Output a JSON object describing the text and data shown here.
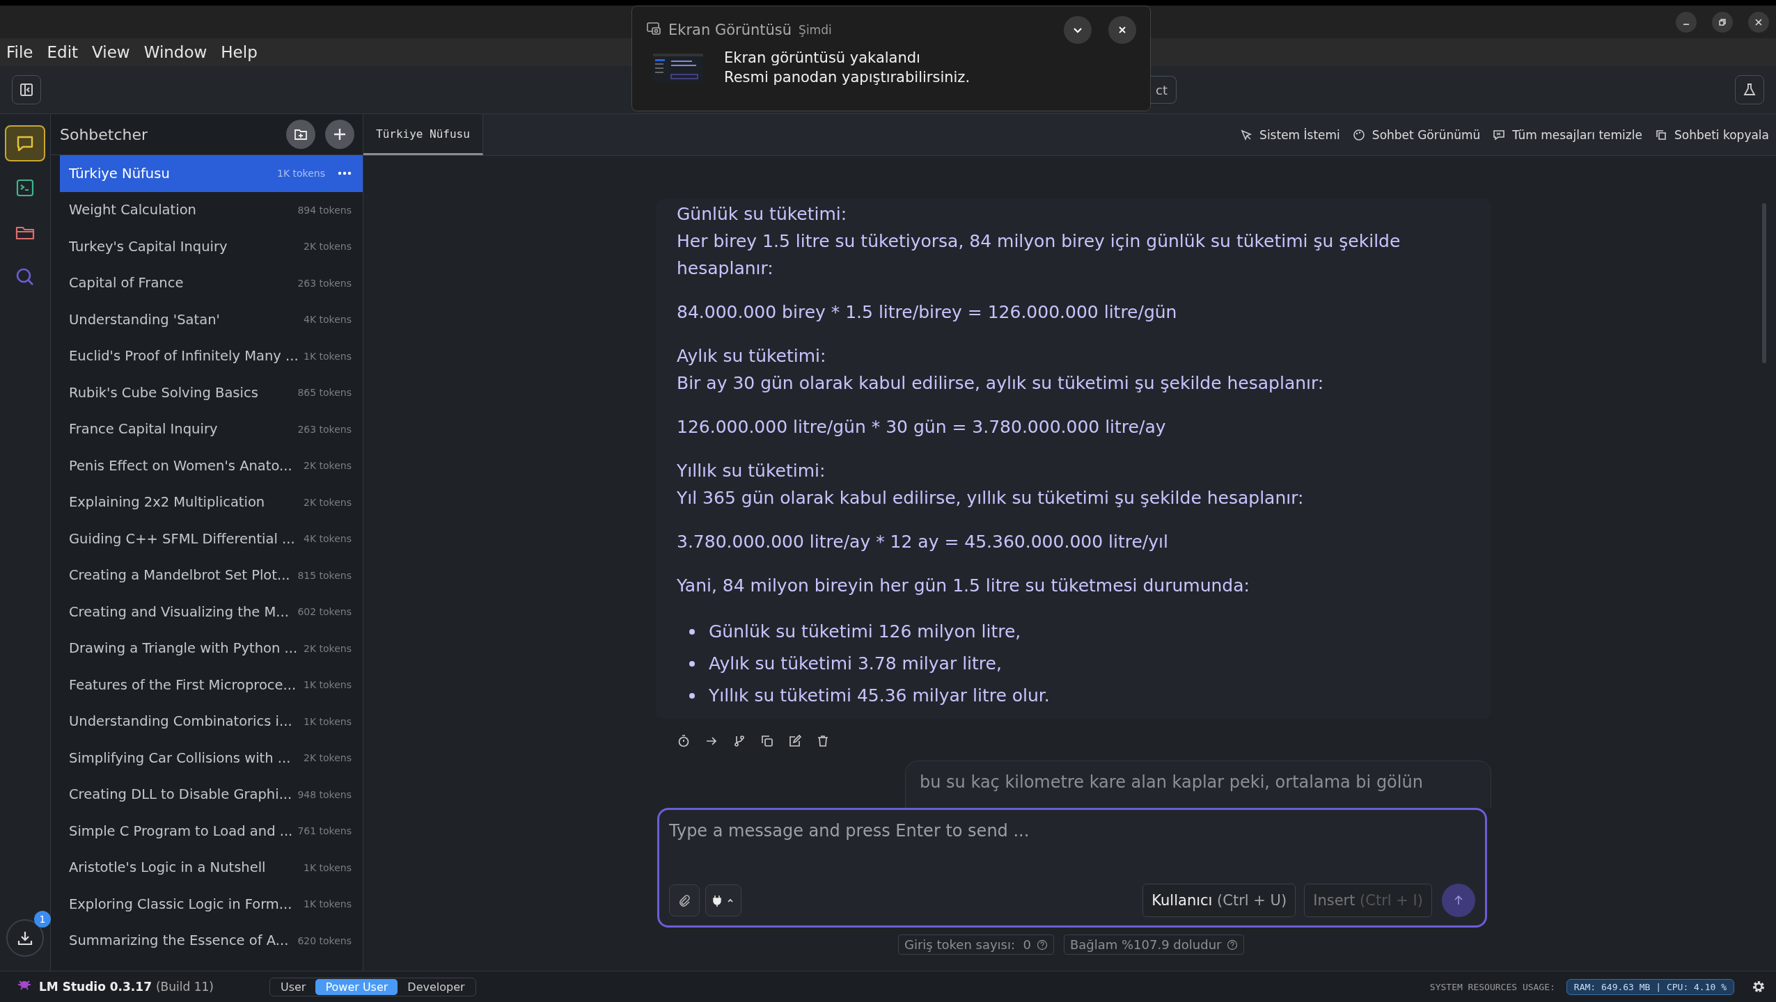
{
  "menu": [
    "File",
    "Edit",
    "View",
    "Window",
    "Help"
  ],
  "notification": {
    "app": "Ekran Görüntüsü",
    "time": "Şimdi",
    "title": "Ekran görüntüsü yakalandı",
    "body": "Resmi panodan yapıştırabilirsiniz."
  },
  "toolbar": {
    "hidden_button_label": "ct"
  },
  "rail": [
    {
      "kind": "chat",
      "selected": true
    },
    {
      "kind": "terminal",
      "selected": false
    },
    {
      "kind": "folder",
      "selected": false
    },
    {
      "kind": "search",
      "selected": false
    }
  ],
  "download_badge": "1",
  "sidebar": {
    "title": "Sohbetcher",
    "chats": [
      {
        "title": "Türkiye Nüfusu",
        "tokens": "1K tokens",
        "selected": true
      },
      {
        "title": "Weight Calculation",
        "tokens": "894 tokens",
        "selected": false
      },
      {
        "title": "Turkey's Capital Inquiry",
        "tokens": "2K tokens",
        "selected": false
      },
      {
        "title": "Capital of France",
        "tokens": "263 tokens",
        "selected": false
      },
      {
        "title": "Understanding 'Satan'",
        "tokens": "4K tokens",
        "selected": false
      },
      {
        "title": "Euclid's Proof of Infinitely Many ...",
        "tokens": "1K tokens",
        "selected": false
      },
      {
        "title": "Rubik's Cube Solving Basics",
        "tokens": "865 tokens",
        "selected": false
      },
      {
        "title": "France Capital Inquiry",
        "tokens": "263 tokens",
        "selected": false
      },
      {
        "title": "Penis Effect on Women's Anato...",
        "tokens": "2K tokens",
        "selected": false
      },
      {
        "title": "Explaining 2x2 Multiplication",
        "tokens": "2K tokens",
        "selected": false
      },
      {
        "title": "Guiding C++ SFML Differential ...",
        "tokens": "4K tokens",
        "selected": false
      },
      {
        "title": "Creating a Mandelbrot Set Plot...",
        "tokens": "815 tokens",
        "selected": false
      },
      {
        "title": "Creating and Visualizing the M...",
        "tokens": "602 tokens",
        "selected": false
      },
      {
        "title": "Drawing a Triangle with Python ...",
        "tokens": "2K tokens",
        "selected": false
      },
      {
        "title": "Features of the First Microproce...",
        "tokens": "1K tokens",
        "selected": false
      },
      {
        "title": "Understanding Combinatorics i...",
        "tokens": "1K tokens",
        "selected": false
      },
      {
        "title": "Simplifying Car Collisions with ...",
        "tokens": "2K tokens",
        "selected": false
      },
      {
        "title": "Creating DLL to Disable Graphi...",
        "tokens": "948 tokens",
        "selected": false
      },
      {
        "title": "Simple C Program to Load and ...",
        "tokens": "761 tokens",
        "selected": false
      },
      {
        "title": "Aristotle's Logic in a Nutshell",
        "tokens": "1K tokens",
        "selected": false
      },
      {
        "title": "Exploring Classic Logic in Form...",
        "tokens": "1K tokens",
        "selected": false
      },
      {
        "title": "Summarizing the Essence of A...",
        "tokens": "620 tokens",
        "selected": false
      }
    ]
  },
  "tabs": [
    {
      "label": "Türkiye Nüfusu",
      "selected": true
    }
  ],
  "chat_actions": [
    {
      "kind": "prompt",
      "label": "Sistem İstemi"
    },
    {
      "kind": "palette",
      "label": "Sohbet Görünümü"
    },
    {
      "kind": "clear",
      "label": "Tüm mesajları temizle"
    },
    {
      "kind": "copy",
      "label": "Sohbeti kopyala"
    }
  ],
  "message": {
    "blocks": [
      {
        "kind": "para",
        "lines": [
          "Günlük su tüketimi:",
          "Her birey 1.5 litre su tüketiyorsa, 84 milyon birey için günlük su tüketimi şu şekilde hesaplanır:"
        ]
      },
      {
        "kind": "para",
        "lines": [
          "84.000.000 birey * 1.5 litre/birey = 126.000.000 litre/gün"
        ]
      },
      {
        "kind": "para",
        "lines": [
          "Aylık su tüketimi:",
          "Bir ay 30 gün olarak kabul edilirse, aylık su tüketimi şu şekilde hesaplanır:"
        ]
      },
      {
        "kind": "para",
        "lines": [
          "126.000.000 litre/gün * 30 gün = 3.780.000.000 litre/ay"
        ]
      },
      {
        "kind": "para",
        "lines": [
          "Yıllık su tüketimi:",
          "Yıl 365 gün olarak kabul edilirse, yıllık su tüketimi şu şekilde hesaplanır:"
        ]
      },
      {
        "kind": "para",
        "lines": [
          "3.780.000.000 litre/ay * 12 ay = 45.360.000.000 litre/yıl"
        ]
      },
      {
        "kind": "para",
        "lines": [
          "Yani, 84 milyon bireyin her gün 1.5 litre su tüketmesi durumunda:"
        ]
      },
      {
        "kind": "list",
        "items": [
          "Günlük su tüketimi 126 milyon litre,",
          "Aylık su tüketimi 3.78 milyar litre,",
          "Yıllık su tüketimi 45.36 milyar litre olur."
        ]
      }
    ]
  },
  "user_message": "bu su kaç kilometre kare alan kaplar peki, ortalama bi gölün",
  "composer": {
    "placeholder": "Type a message and press Enter to send ...",
    "role_button": {
      "label": "Kullanıcı",
      "shortcut": "(Ctrl + U)"
    },
    "insert_button": {
      "label": "Insert",
      "shortcut": "(Ctrl + I)"
    }
  },
  "token_info": [
    "Giriş token sayısı:  0",
    "Bağlam %107.9 doludur"
  ],
  "status_bar": {
    "app": "LM Studio 0.3.17",
    "build": "(Build 11)",
    "modes": [
      {
        "label": "User",
        "selected": false
      },
      {
        "label": "Power User",
        "selected": true
      },
      {
        "label": "Developer",
        "selected": false
      }
    ],
    "resources_label": "SYSTEM RESOURCES USAGE:",
    "resources": "RAM: 649.63 MB | CPU: 4.10 %"
  }
}
